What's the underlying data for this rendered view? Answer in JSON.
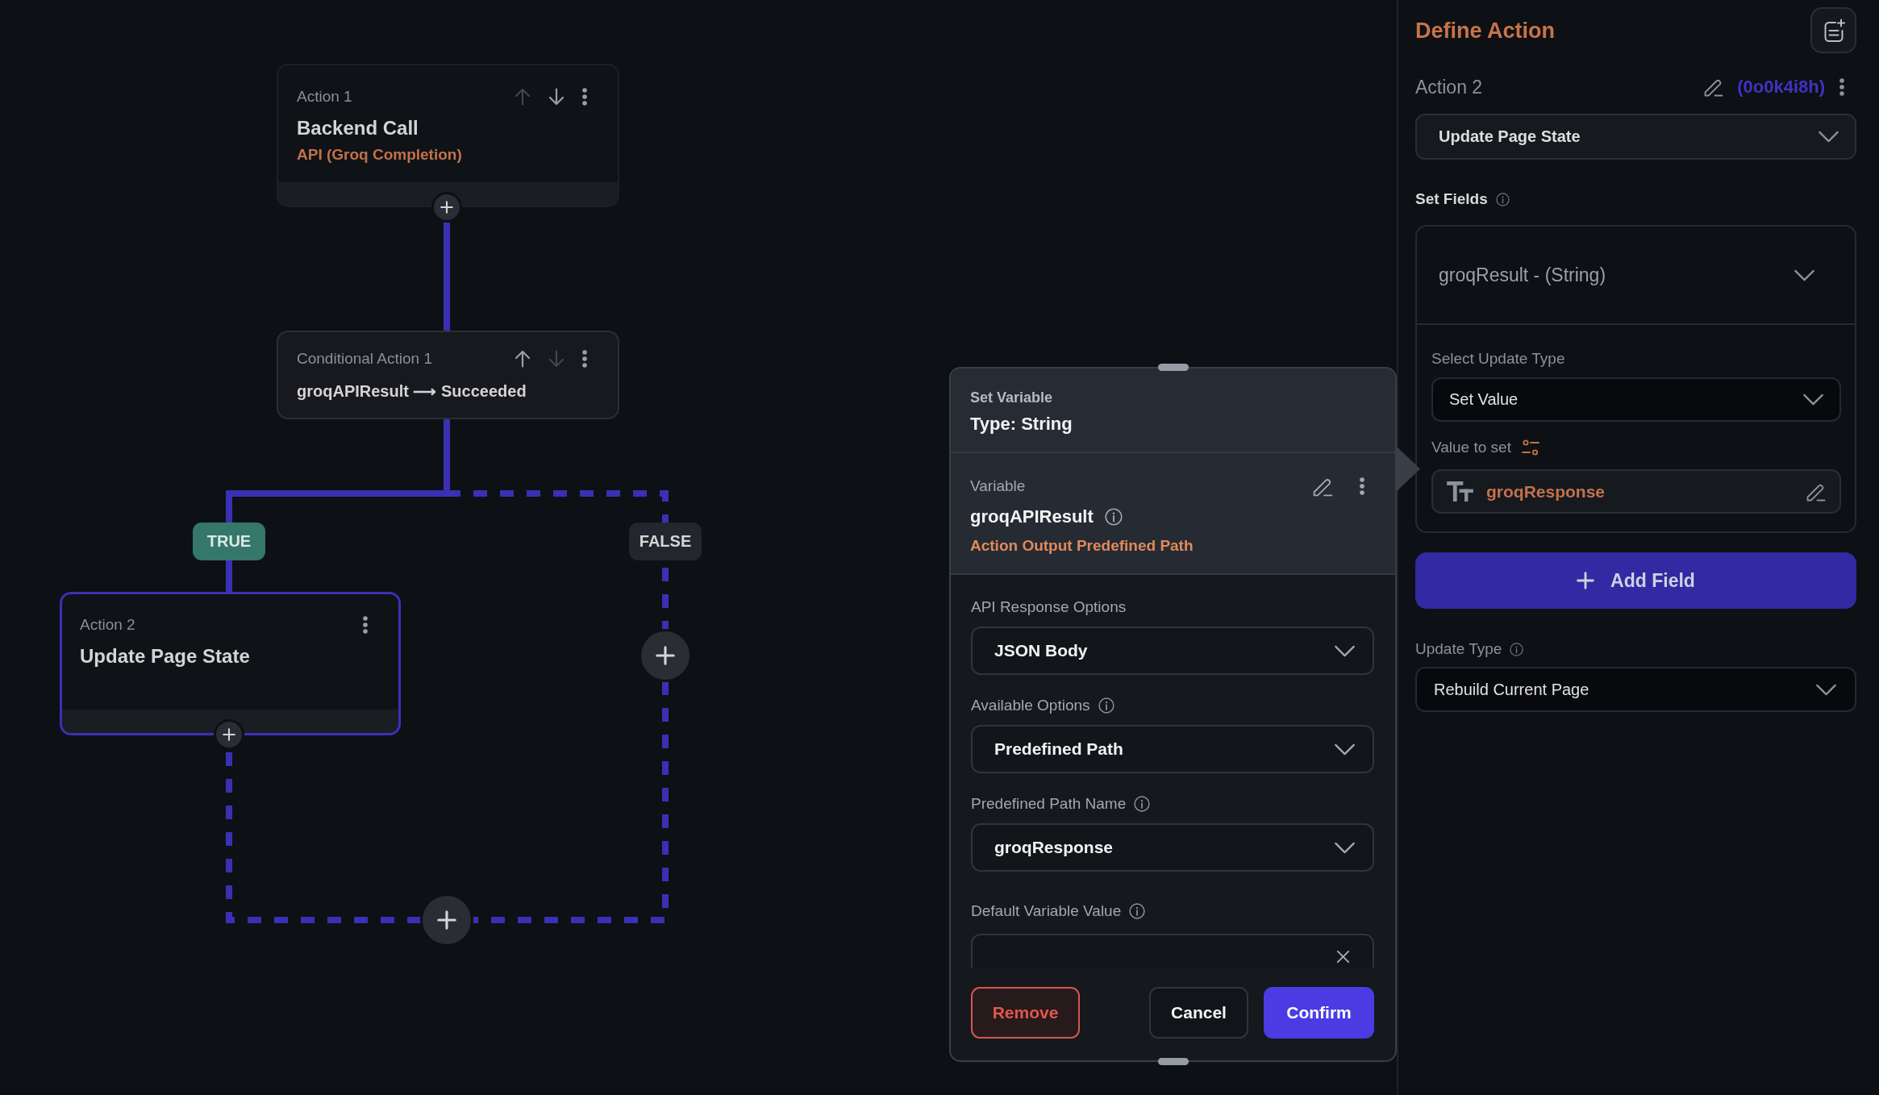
{
  "canvas": {
    "nodes": [
      {
        "kind": "action",
        "label": "Action 1",
        "title": "Backend Call",
        "subtitle": "API (Groq Completion)",
        "selected": false,
        "move_buttons": [
          {
            "kind": "up",
            "disabled": true
          },
          {
            "kind": "down",
            "disabled": false
          }
        ]
      },
      {
        "kind": "conditional",
        "label": "Conditional Action 1",
        "title": "groqAPIResult ⟶ Succeeded",
        "selected": false,
        "move_buttons": [
          {
            "kind": "up",
            "disabled": false
          },
          {
            "kind": "down",
            "disabled": true
          }
        ]
      },
      {
        "kind": "action",
        "label": "Action 2",
        "title": "Update Page State",
        "selected": true
      }
    ],
    "branches": [
      {
        "label": "TRUE",
        "active": true
      },
      {
        "label": "FALSE",
        "active": false
      }
    ]
  },
  "variable_panel": {
    "title": "Set Variable",
    "type": "Type: String",
    "variable": {
      "label": "Variable",
      "name": "groqAPIResult",
      "source": "Action Output Predefined Path"
    },
    "fields": [
      {
        "kind": "dropdown",
        "label": "API Response Options",
        "value": "JSON Body",
        "info": false
      },
      {
        "kind": "dropdown",
        "label": "Available Options",
        "value": "Predefined Path",
        "info": true
      },
      {
        "kind": "dropdown",
        "label": "Predefined Path Name",
        "value": "groqResponse",
        "info": true
      },
      {
        "kind": "text",
        "label": "Default Variable Value",
        "info": true
      }
    ],
    "buttons": [
      {
        "kind": "danger",
        "label": "Remove"
      },
      {
        "kind": "secondary",
        "label": "Cancel"
      },
      {
        "kind": "primary",
        "label": "Confirm"
      }
    ]
  },
  "sidebar": {
    "title": "Define Action",
    "action_label": "Action 2",
    "action_id": "(0o0k4i8h)",
    "action_type": "Update Page State",
    "set_fields": {
      "label": "Set Fields",
      "info": true,
      "items": [
        {
          "field": "groqResult - (String)",
          "expanded": true,
          "update_type_label": "Select Update Type",
          "update_type": "Set Value",
          "value_label": "Value to set",
          "value": "groqResponse"
        }
      ]
    },
    "add_button": "Add Field",
    "update_type": {
      "label": "Update Type",
      "info": true,
      "value": "Rebuild Current Page"
    }
  }
}
